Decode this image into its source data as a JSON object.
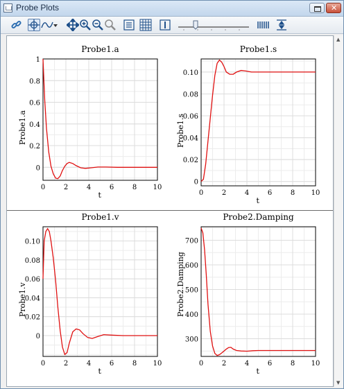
{
  "window": {
    "title": "Probe Plots"
  },
  "toolbar": {
    "icons": [
      "link-icon",
      "crosshair-icon",
      "curve-select-icon",
      "dropdown-arrow-icon",
      "pan-icon",
      "zoom-in-icon",
      "zoom-out-icon",
      "zoom-reset-icon",
      "legend-icon",
      "grid-icon",
      "box-icon",
      "slider",
      "spectrum-icon",
      "fit-icon"
    ]
  },
  "colors": {
    "curve": "#e01010",
    "grid": "#dcdcdc",
    "axis": "#000000"
  },
  "chart_data": [
    {
      "type": "line",
      "title": "Probe1.a",
      "xlabel": "t",
      "ylabel": "Probe1.a",
      "xlim": [
        0,
        10
      ],
      "ylim": [
        -0.12,
        1.0
      ],
      "xticks": [
        "0",
        "2",
        "4",
        "6",
        "8",
        "10"
      ],
      "yticks": [
        "0",
        "0.2",
        "0.4",
        "0.6",
        "0.8",
        "1"
      ],
      "grid": true,
      "series": [
        {
          "x": [
            0,
            0.15,
            0.3,
            0.5,
            0.7,
            0.9,
            1.1,
            1.3,
            1.5,
            1.7,
            1.9,
            2.1,
            2.3,
            2.6,
            2.9,
            3.3,
            3.7,
            4.2,
            4.8,
            5.5,
            6.5,
            8,
            10
          ],
          "y": [
            1.0,
            0.62,
            0.36,
            0.14,
            0.01,
            -0.06,
            -0.1,
            -0.105,
            -0.08,
            -0.03,
            0.01,
            0.035,
            0.045,
            0.035,
            0.015,
            -0.005,
            -0.01,
            -0.005,
            0.002,
            0.002,
            0,
            0,
            0
          ]
        }
      ]
    },
    {
      "type": "line",
      "title": "Probe1.s",
      "xlabel": "t",
      "ylabel": "Probe1.s",
      "xlim": [
        0,
        10
      ],
      "ylim": [
        -0.004,
        0.112
      ],
      "xticks": [
        "0",
        "2",
        "4",
        "6",
        "8",
        "10"
      ],
      "yticks": [
        "0",
        "0.02",
        "0.04",
        "0.06",
        "0.08",
        "0.10"
      ],
      "grid": true,
      "series": [
        {
          "x": [
            0,
            0.2,
            0.4,
            0.6,
            0.8,
            1.0,
            1.2,
            1.4,
            1.6,
            1.8,
            2.0,
            2.2,
            2.5,
            2.8,
            3.1,
            3.5,
            3.9,
            4.4,
            5,
            6,
            8,
            10
          ],
          "y": [
            0,
            0.002,
            0.016,
            0.037,
            0.058,
            0.079,
            0.097,
            0.108,
            0.111,
            0.109,
            0.105,
            0.1,
            0.098,
            0.098,
            0.1,
            0.1015,
            0.101,
            0.1,
            0.1,
            0.1,
            0.1,
            0.1
          ]
        }
      ]
    },
    {
      "type": "line",
      "title": "Probe1.v",
      "xlabel": "t",
      "ylabel": "Probe1.v",
      "xlim": [
        0,
        10
      ],
      "ylim": [
        -0.022,
        0.115
      ],
      "xticks": [
        "0",
        "2",
        "4",
        "6",
        "8",
        "10"
      ],
      "yticks": [
        "0",
        "0.02",
        "0.04",
        "0.06",
        "0.08",
        "0.10"
      ],
      "grid": true,
      "series": [
        {
          "x": [
            0,
            0.1,
            0.25,
            0.4,
            0.55,
            0.7,
            0.9,
            1.1,
            1.3,
            1.5,
            1.7,
            1.9,
            2.1,
            2.3,
            2.6,
            2.9,
            3.2,
            3.5,
            3.9,
            4.3,
            4.8,
            5.3,
            6,
            7,
            8,
            10
          ],
          "y": [
            0.06,
            0.1,
            0.11,
            0.113,
            0.11,
            0.1,
            0.082,
            0.058,
            0.03,
            0.005,
            -0.012,
            -0.02,
            -0.018,
            -0.008,
            0.004,
            0.007,
            0.006,
            0.002,
            -0.002,
            -0.003,
            -0.001,
            0.001,
            0.0005,
            0,
            0,
            0
          ]
        }
      ]
    },
    {
      "type": "line",
      "title": "Probe2.Damping",
      "xlabel": "t",
      "ylabel": "Probe2.Damping",
      "xlim": [
        0,
        10
      ],
      "ylim": [
        228,
        755
      ],
      "xticks": [
        "0",
        "2",
        "4",
        "6",
        "8",
        "10"
      ],
      "yticks": [
        "300",
        "400",
        "500",
        "600",
        "700"
      ],
      "grid": true,
      "series": [
        {
          "x": [
            0,
            0.15,
            0.3,
            0.45,
            0.6,
            0.8,
            1.0,
            1.2,
            1.4,
            1.6,
            1.8,
            2.0,
            2.2,
            2.4,
            2.6,
            2.8,
            3.1,
            3.5,
            4,
            4.5,
            5,
            6,
            8,
            10
          ],
          "y": [
            750,
            730,
            660,
            560,
            440,
            330,
            270,
            240,
            232,
            235,
            242,
            250,
            258,
            264,
            265,
            258,
            252,
            250,
            249,
            251,
            252,
            252,
            252,
            252
          ]
        }
      ]
    }
  ]
}
